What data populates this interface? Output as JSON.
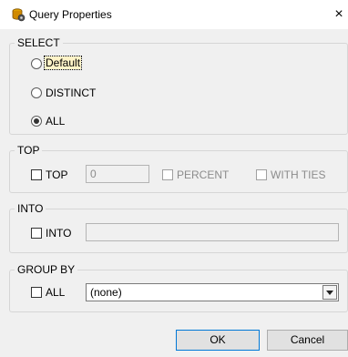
{
  "window": {
    "title": "Query Properties",
    "close_glyph": "×"
  },
  "select_group": {
    "legend": "SELECT",
    "options": [
      {
        "label": "Default",
        "checked": false
      },
      {
        "label": "DISTINCT",
        "checked": false
      },
      {
        "label": "ALL",
        "checked": true
      }
    ]
  },
  "top_group": {
    "legend": "TOP",
    "top_label": "TOP",
    "top_value": "0",
    "percent_label": "PERCENT",
    "with_ties_label": "WITH TIES"
  },
  "into_group": {
    "legend": "INTO",
    "into_label": "INTO",
    "into_value": ""
  },
  "group_by_group": {
    "legend": "GROUP BY",
    "all_label": "ALL",
    "select_value": "(none)"
  },
  "buttons": {
    "ok": "OK",
    "cancel": "Cancel"
  },
  "colors": {
    "accent": "#0078d7",
    "window_bg": "#f0f0f0",
    "border": "#d6d6d6"
  },
  "icons": {
    "app": "database-properties-icon",
    "close": "close-icon",
    "dropdown": "chevron-down-icon"
  }
}
